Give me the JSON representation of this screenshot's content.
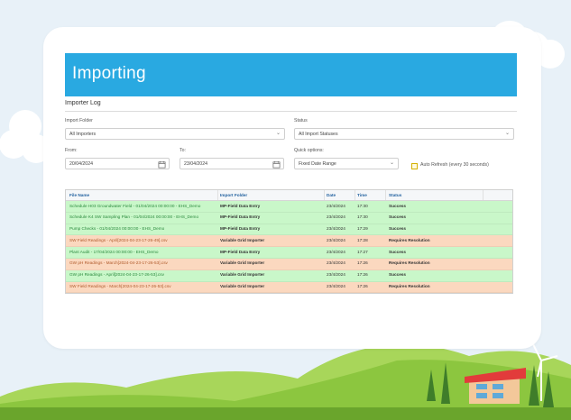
{
  "page": {
    "title": "Importing",
    "section_title": "Importer Log"
  },
  "filters": {
    "importer_folder_label": "Import Folder",
    "importer_folder_value": "All Importers",
    "status_label": "Status",
    "status_value": "All Import Statuses",
    "from_label": "From:",
    "from_value": "20/04/2024",
    "to_label": "To:",
    "to_value": "23/04/2024",
    "quick_options_label": "Quick options:",
    "quick_options_value": "Fixed Date Range",
    "auto_refresh_label": "Auto Refresh (every 30 seconds)"
  },
  "table": {
    "columns": [
      "File Name",
      "Import Folder",
      "Date",
      "Time",
      "Status"
    ],
    "rows": [
      {
        "file": "Schedule H03 Groundwater Field - 01/04/2024 00:00:00 - EHS_Demo",
        "folder": "MP-Field Data Entry",
        "date": "23/4/2024",
        "time": "17:30",
        "status": "Success",
        "state": "ok"
      },
      {
        "file": "Schedule K4 SW Sampling Plan - 01/04/2024 00:00:00 - EHS_Demo",
        "folder": "MP-Field Data Entry",
        "date": "23/4/2024",
        "time": "17:30",
        "status": "Success",
        "state": "ok"
      },
      {
        "file": "Pump Checks - 01/04/2024 00:00:00 - EHS_Demo",
        "folder": "MP-Field Data Entry",
        "date": "23/4/2024",
        "time": "17:29",
        "status": "Success",
        "state": "ok"
      },
      {
        "file": "SW Field Readings - April[2024-04-23-17-26-49].csv",
        "folder": "Variable Grid Importer",
        "date": "23/4/2024",
        "time": "17:28",
        "status": "Requires Resolution",
        "state": "err"
      },
      {
        "file": "Plant Audit - 17/04/2024 00:00:00 - EHS_Demo",
        "folder": "MP-Field Data Entry",
        "date": "23/4/2024",
        "time": "17:27",
        "status": "Success",
        "state": "ok"
      },
      {
        "file": "GW pH Readings - March[2024-04-23-17-26-53].csv",
        "folder": "Variable Grid Importer",
        "date": "23/4/2024",
        "time": "17:26",
        "status": "Requires Resolution",
        "state": "err"
      },
      {
        "file": "GW pH Readings - April[2024-04-23-17-26-53].csv",
        "folder": "Variable Grid Importer",
        "date": "23/4/2024",
        "time": "17:26",
        "status": "Success",
        "state": "ok"
      },
      {
        "file": "SW Field Readings - March[2024-04-23-17-26-53].csv",
        "folder": "Variable Grid Importer",
        "date": "23/4/2024",
        "time": "17:26",
        "status": "Requires Resolution",
        "state": "err"
      }
    ]
  },
  "colors": {
    "banner": "#29a9e1",
    "success_row": "#c9f7c9",
    "error_row": "#fbd8bf",
    "hills": "#8cc63f"
  }
}
